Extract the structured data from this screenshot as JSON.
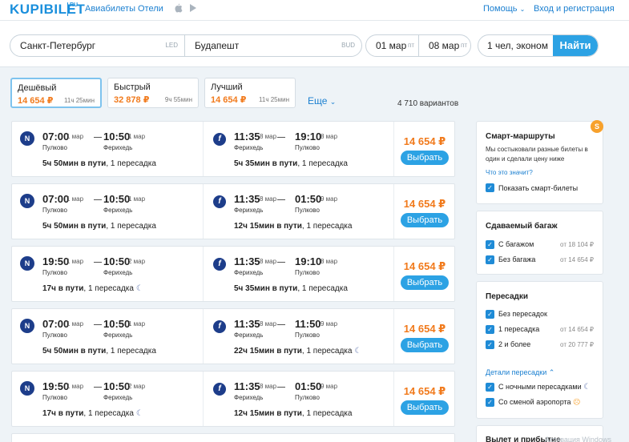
{
  "header": {
    "logo": "KUPIBILET",
    "logo_suffix": "RU",
    "nav": [
      "Авиабилеты",
      "Отели"
    ],
    "os_icons": [
      "apple-icon",
      "android-icon"
    ],
    "help": "Помощь",
    "login": "Вход и регистрация"
  },
  "search": {
    "from_city": "Санкт-Петербург",
    "from_code": "LED",
    "to_city": "Будапешт",
    "to_code": "BUD",
    "date_out": "01 мар",
    "date_out_dow": "пт",
    "date_back": "08 мар",
    "date_back_dow": "пт",
    "passengers": "1 чел, эконом",
    "find_label": "Найти"
  },
  "sort_tabs": [
    {
      "name": "Дешёвый",
      "price": "14 654 ₽",
      "duration": "11ч 25мин"
    },
    {
      "name": "Быстрый",
      "price": "32 878 ₽",
      "duration": "9ч 55мин"
    },
    {
      "name": "Лучший",
      "price": "14 654 ₽",
      "duration": "11ч 25мин"
    }
  ],
  "more_label": "Еще",
  "variants": "4 710 вариантов",
  "results": [
    {
      "out": {
        "dep_time": "07:00",
        "dep_date": "1 мар",
        "arr_time": "10:50",
        "arr_date": "1 мар",
        "dep_ap": "Пулково",
        "arr_ap": "Ферихедь",
        "duration": "5ч 50мин в пути",
        "stops": ", 1 пересадка",
        "night": ""
      },
      "back": {
        "dep_time": "11:35",
        "dep_date": "8 мар",
        "arr_time": "19:10",
        "arr_date": "8 мар",
        "dep_ap": "Ферихедь",
        "arr_ap": "Пулково",
        "duration": "5ч 35мин в пути",
        "stops": ", 1 пересадка",
        "night": ""
      },
      "price": "14 654 ₽",
      "choose": "Выбрать"
    },
    {
      "out": {
        "dep_time": "07:00",
        "dep_date": "1 мар",
        "arr_time": "10:50",
        "arr_date": "1 мар",
        "dep_ap": "Пулково",
        "arr_ap": "Ферихедь",
        "duration": "5ч 50мин в пути",
        "stops": ", 1 пересадка",
        "night": ""
      },
      "back": {
        "dep_time": "11:35",
        "dep_date": "8 мар",
        "arr_time": "01:50",
        "arr_date": "9 мар",
        "dep_ap": "Ферихедь",
        "arr_ap": "Пулково",
        "duration": "12ч 15мин в пути",
        "stops": ", 1 пересадка",
        "night": ""
      },
      "price": "14 654 ₽",
      "choose": "Выбрать"
    },
    {
      "out": {
        "dep_time": "19:50",
        "dep_date": "1 мар",
        "arr_time": "10:50",
        "arr_date": "2 мар",
        "dep_ap": "Пулково",
        "arr_ap": "Ферихедь",
        "duration": "17ч в пути",
        "stops": ", 1 пересадка",
        "night": "☾"
      },
      "back": {
        "dep_time": "11:35",
        "dep_date": "8 мар",
        "arr_time": "19:10",
        "arr_date": "8 мар",
        "dep_ap": "Ферихедь",
        "arr_ap": "Пулково",
        "duration": "5ч 35мин в пути",
        "stops": ", 1 пересадка",
        "night": ""
      },
      "price": "14 654 ₽",
      "choose": "Выбрать"
    },
    {
      "out": {
        "dep_time": "07:00",
        "dep_date": "1 мар",
        "arr_time": "10:50",
        "arr_date": "1 мар",
        "dep_ap": "Пулково",
        "arr_ap": "Ферихедь",
        "duration": "5ч 50мин в пути",
        "stops": ", 1 пересадка",
        "night": ""
      },
      "back": {
        "dep_time": "11:35",
        "dep_date": "8 мар",
        "arr_time": "11:50",
        "arr_date": "9 мар",
        "dep_ap": "Ферихедь",
        "arr_ap": "Пулково",
        "duration": "22ч 15мин в пути",
        "stops": ", 1 пересадка",
        "night": "☾"
      },
      "price": "14 654 ₽",
      "choose": "Выбрать"
    },
    {
      "out": {
        "dep_time": "19:50",
        "dep_date": "1 мар",
        "arr_time": "10:50",
        "arr_date": "2 мар",
        "dep_ap": "Пулково",
        "arr_ap": "Ферихедь",
        "duration": "17ч в пути",
        "stops": ", 1 пересадка",
        "night": "☾"
      },
      "back": {
        "dep_time": "11:35",
        "dep_date": "8 мар",
        "arr_time": "01:50",
        "arr_date": "9 мар",
        "dep_ap": "Ферихедь",
        "arr_ap": "Пулково",
        "duration": "12ч 15мин в пути",
        "stops": ", 1 пересадка",
        "night": ""
      },
      "price": "14 654 ₽",
      "choose": "Выбрать"
    }
  ],
  "sidebar": {
    "smart": {
      "badge": "S",
      "title": "Смарт-маршруты",
      "text": "Мы состыковали разные билеты в один и сделали цену ниже",
      "link": "Что это значит?",
      "checkbox": "Показать смарт-билеты"
    },
    "baggage": {
      "title": "Сдаваемый багаж",
      "options": [
        {
          "label": "С багажом",
          "price": "от 18 104 ₽"
        },
        {
          "label": "Без багажа",
          "price": "от 14 654 ₽"
        }
      ]
    },
    "transfers": {
      "title": "Пересадки",
      "options": [
        {
          "label": "Без пересадок",
          "price": ""
        },
        {
          "label": "1 пересадка",
          "price": "от 14 654 ₽"
        },
        {
          "label": "2 и более",
          "price": "от 20 777 ₽"
        }
      ],
      "details": "Детали пересадки",
      "extra": [
        {
          "label": "С ночными пересадками",
          "icon": "moon-icon"
        },
        {
          "label": "Со сменой аэропорта",
          "icon": "warning-icon"
        }
      ]
    },
    "next_title": "Вылет и прибытие"
  },
  "watermark": "Активация Windows",
  "colors": {
    "accent": "#2ca2e4",
    "price": "#f17a1c",
    "link": "#1a7fd0"
  }
}
